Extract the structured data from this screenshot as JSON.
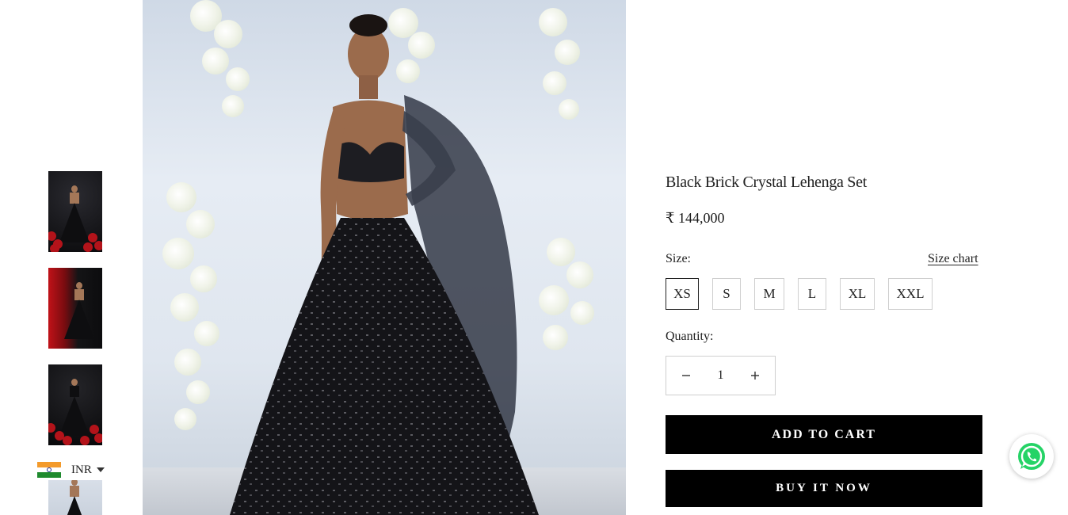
{
  "product": {
    "title": "Black Brick Crystal Lehenga Set",
    "price": "₹ 144,000",
    "size_label": "Size:",
    "size_chart_label": "Size chart",
    "sizes": [
      "XS",
      "S",
      "M",
      "L",
      "XL",
      "XXL"
    ],
    "selected_size": "XS",
    "quantity_label": "Quantity:",
    "quantity": "1",
    "add_to_cart_label": "ADD TO CART",
    "buy_now_label": "BUY IT NOW"
  },
  "currency": {
    "code": "INR",
    "flag": "india-flag-icon"
  },
  "icons": {
    "minus": "minus-icon",
    "plus": "plus-icon",
    "chat": "whatsapp-icon",
    "dropdown": "caret-down-icon"
  },
  "colors": {
    "button_bg": "#000000",
    "whatsapp": "#25D366",
    "rose": "#b3131a"
  }
}
